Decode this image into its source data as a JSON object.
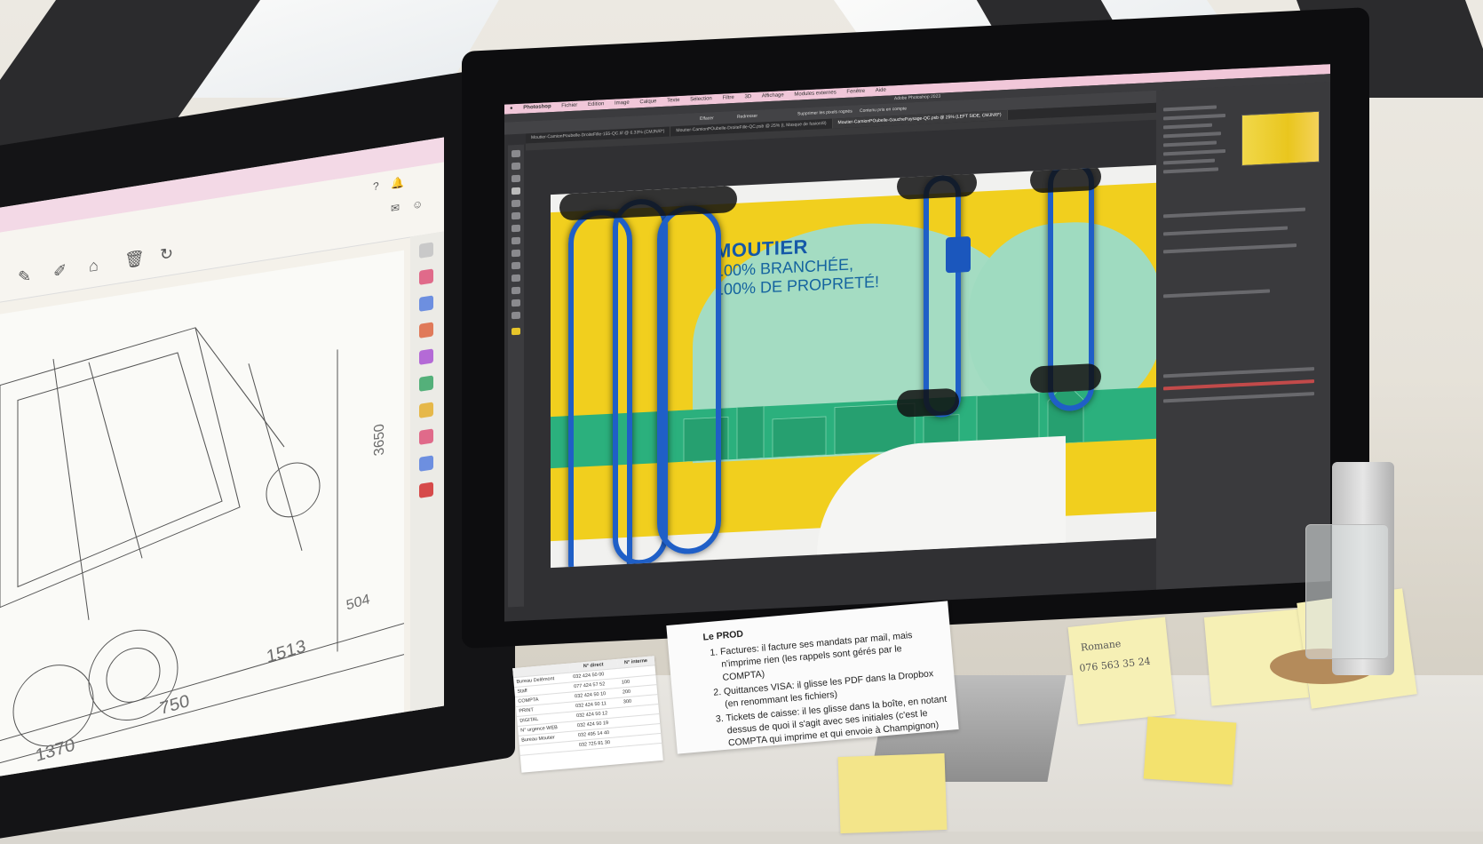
{
  "left_monitor": {
    "dimensions": [
      "1370",
      "750",
      "1513",
      "504",
      "3650"
    ]
  },
  "photoshop": {
    "app_name": "Photoshop",
    "window_title": "Adobe Photoshop 2023",
    "menu": [
      "Fichier",
      "Edition",
      "Image",
      "Calque",
      "Texte",
      "Sélection",
      "Filtre",
      "3D",
      "Affichage",
      "Modules externes",
      "Fenêtre",
      "Aide"
    ],
    "document_tabs": [
      "Moutier-CamionPoubelle-DroiteFille-155-QC.tif @ 6.33% (CMJN/8*)",
      "Moutier-CamionPOubelle-DroiteFille-QC.psb @ 25% (L Masque de fusion/8)",
      "Moutier-CamionPOubelle-GauchePaysage-QC.psb @ 25% (LEFT SIDE, CMJN/8*)"
    ],
    "options": [
      "Supprimer les pixels rognés",
      "Contenu pris en compte",
      "Effacer",
      "Redresser"
    ]
  },
  "artwork": {
    "headline_1": "MOUTIER",
    "headline_2": "100% BRANCHÉE,",
    "headline_3": "100% DE PROPRETÉ!"
  },
  "note": {
    "title": "Le PROD",
    "items": [
      "Factures: il facture ses mandats par mail, mais n'imprime rien (les rappels sont gérés par le COMPTA)",
      "Quittances VISA: il glisse les PDF dans la Dropbox (en renommant les fichiers)",
      "Tickets de caisse: il les glisse dans la boîte, en notant dessus de quoi il s'agit avec ses initiales (c'est le COMPTA qui imprime et qui envoie à Champignon)"
    ]
  },
  "phone_card": {
    "headers": [
      "",
      "N° direct",
      "N° interne"
    ],
    "rows": [
      [
        "Bureau Delémont",
        "032 424 50 00",
        ""
      ],
      [
        "Staff",
        "077 424 57 52",
        "100"
      ],
      [
        "COMPTA",
        "032 424 50 10",
        "200"
      ],
      [
        "PRINT",
        "032 424 50 11",
        "300"
      ],
      [
        "DIGITAL",
        "032 424 50 12",
        ""
      ],
      [
        "N° urgence WEB",
        "032 424 50 19",
        ""
      ],
      [
        "Bureau Moutier",
        "032 495 14 40",
        ""
      ],
      [
        "",
        "032 725 81 30",
        ""
      ]
    ]
  },
  "stickies": {
    "romane_name": "Romane",
    "romane_phone": "076 563 35 24"
  }
}
